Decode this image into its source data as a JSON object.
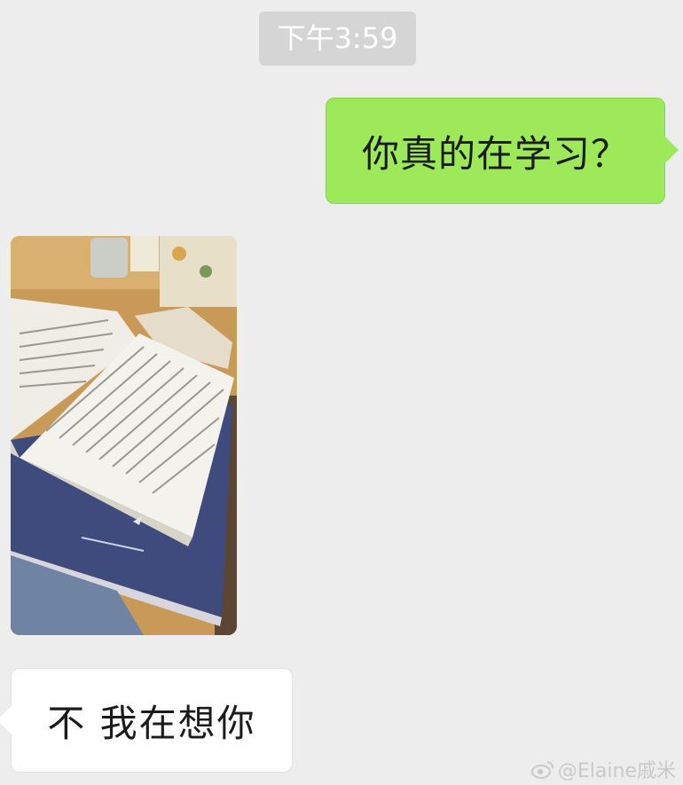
{
  "chat": {
    "timestamp": "下午3:59",
    "messages": [
      {
        "sender": "self",
        "type": "text",
        "text": "你真的在学习？"
      },
      {
        "sender": "other",
        "type": "image",
        "image": "photo of an open book on a notebook on a wooden desk"
      },
      {
        "sender": "other",
        "type": "text",
        "text": "不 我在想你"
      }
    ]
  },
  "watermark": {
    "text": "@Elaine戚米",
    "icon": "weibo-icon"
  },
  "colors": {
    "background": "#ededed",
    "sent_bubble": "#9de95a",
    "received_bubble": "#ffffff",
    "timestamp_bg": "#d5d5d5"
  }
}
